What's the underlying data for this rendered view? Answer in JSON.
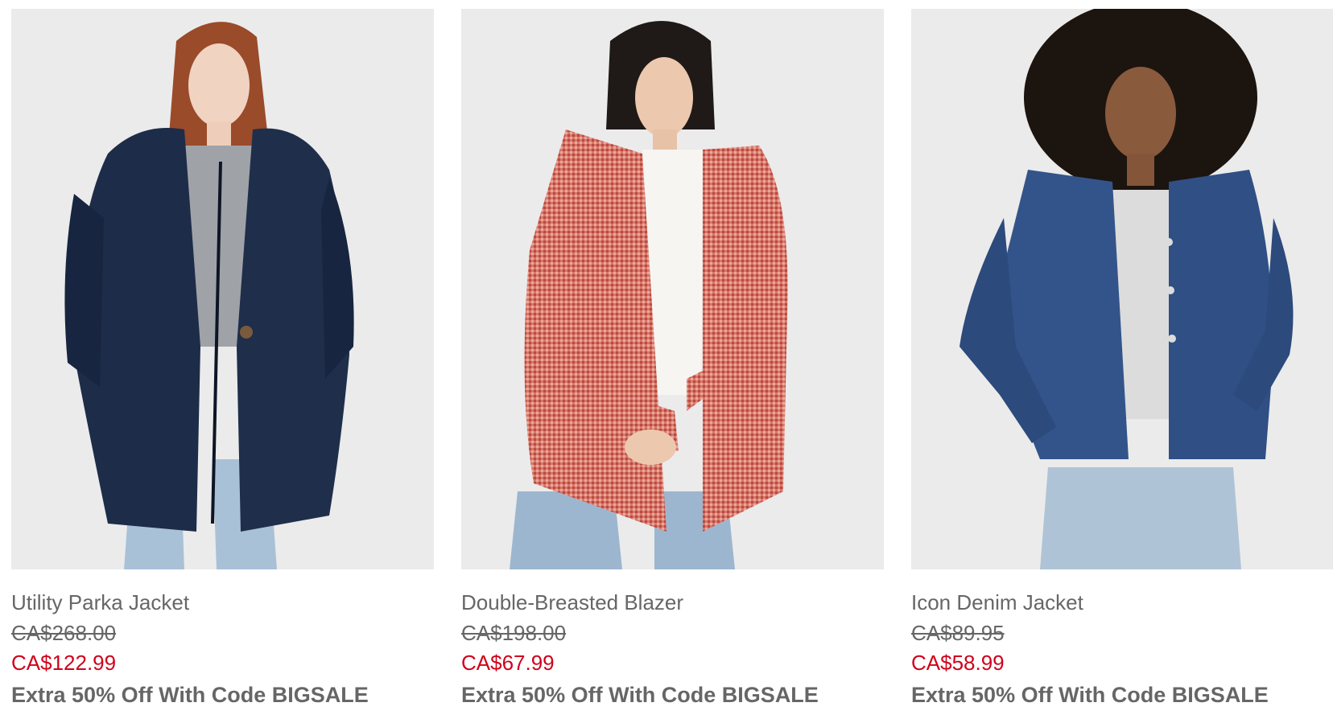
{
  "products": [
    {
      "name": "Utility Parka Jacket",
      "original_price": "CA$268.00",
      "sale_price": "CA$122.99",
      "promo": "Extra 50% Off With Code BIGSALE",
      "image_icon": "parka-jacket-photo"
    },
    {
      "name": "Double-Breasted Blazer",
      "original_price": "CA$198.00",
      "sale_price": "CA$67.99",
      "promo": "Extra 50% Off With Code BIGSALE",
      "image_icon": "blazer-photo"
    },
    {
      "name": "Icon Denim Jacket",
      "original_price": "CA$89.95",
      "sale_price": "CA$58.99",
      "promo": "Extra 50% Off With Code BIGSALE",
      "image_icon": "denim-jacket-photo"
    }
  ],
  "colors": {
    "sale_price": "#d0021b",
    "text": "#666666",
    "image_background": "#ebebeb"
  }
}
